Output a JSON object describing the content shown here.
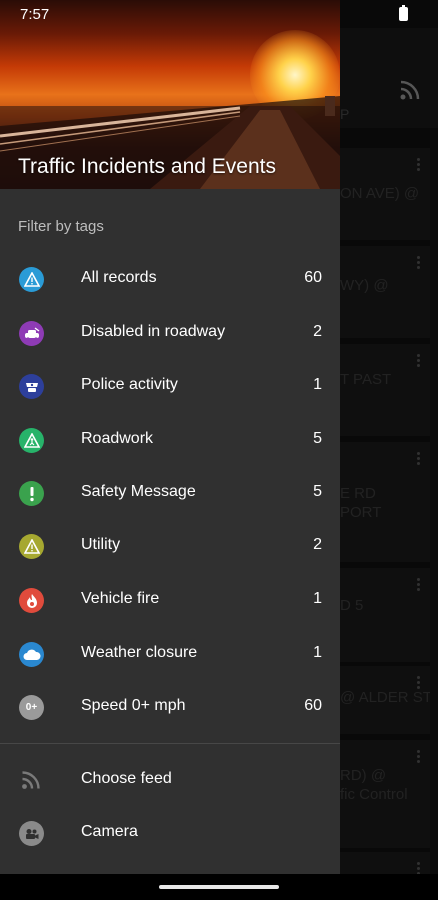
{
  "status_bar": {
    "time": "7:57"
  },
  "drawer": {
    "title": "Traffic Incidents and Events",
    "section_label": "Filter by tags",
    "tags": [
      {
        "label": "All records",
        "count": "60",
        "icon": "warning-triangle-icon",
        "color": "#2a9bd6"
      },
      {
        "label": "Disabled in roadway",
        "count": "2",
        "icon": "disabled-car-icon",
        "color": "#8e3bb5"
      },
      {
        "label": "Police activity",
        "count": "1",
        "icon": "police-badge-icon",
        "color": "#2d3f9b"
      },
      {
        "label": "Roadwork",
        "count": "5",
        "icon": "roadwork-icon",
        "color": "#27b36a"
      },
      {
        "label": "Safety Message",
        "count": "5",
        "icon": "exclamation-icon",
        "color": "#3aa24d"
      },
      {
        "label": "Utility",
        "count": "2",
        "icon": "utility-warning-icon",
        "color": "#a6a830"
      },
      {
        "label": "Vehicle fire",
        "count": "1",
        "icon": "vehicle-fire-icon",
        "color": "#e04b3c"
      },
      {
        "label": "Weather closure",
        "count": "1",
        "icon": "cloud-icon",
        "color": "#2a88d0"
      },
      {
        "label": "Speed 0+ mph",
        "count": "60",
        "icon": "speed-icon",
        "color": "#9a9a9a",
        "glyph": "0+"
      }
    ],
    "actions": [
      {
        "label": "Choose feed",
        "icon": "rss-icon"
      },
      {
        "label": "Camera",
        "icon": "camera-icon"
      }
    ]
  },
  "background_list": [
    {
      "text": "ON AVE) @"
    },
    {
      "text": "WY) @"
    },
    {
      "text": "T PAST"
    },
    {
      "text": "E RD\nPORT"
    },
    {
      "text": "D 5"
    },
    {
      "text": "@ ALDER ST"
    },
    {
      "text": "RD) @\nfic Control"
    }
  ],
  "background_tab_fragment": "P"
}
